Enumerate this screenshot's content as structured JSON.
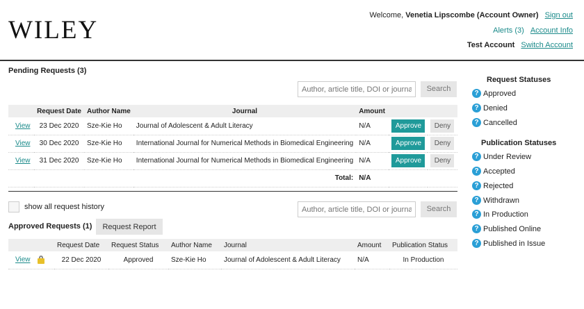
{
  "header": {
    "logo": "WILEY",
    "welcome_prefix": "Welcome, ",
    "user_name": "Venetia Lipscombe (Account Owner)",
    "sign_out": "Sign out",
    "alerts": "Alerts (3)",
    "account_info": "Account Info",
    "test_account": "Test Account",
    "switch_account": "Switch Account"
  },
  "pending": {
    "title": "Pending Requests (3)",
    "search_placeholder": "Author, article title, DOI or journal",
    "search_button": "Search",
    "columns": [
      "",
      "Request Date",
      "Author Name",
      "Journal",
      "Amount",
      "",
      ""
    ],
    "rows": [
      {
        "view": "View",
        "date": "23 Dec 2020",
        "author": "Sze-Kie Ho",
        "journal": "Journal of Adolescent & Adult Literacy",
        "amount": "N/A",
        "approve": "Approve",
        "deny": "Deny"
      },
      {
        "view": "View",
        "date": "30 Dec 2020",
        "author": "Sze-Kie Ho",
        "journal": "International Journal for Numerical Methods in Biomedical Engineering",
        "amount": "N/A",
        "approve": "Approve",
        "deny": "Deny"
      },
      {
        "view": "View",
        "date": "31 Dec 2020",
        "author": "Sze-Kie Ho",
        "journal": "International Journal for Numerical Methods in Biomedical Engineering",
        "amount": "N/A",
        "approve": "Approve",
        "deny": "Deny"
      }
    ],
    "total_label": "Total:",
    "total_value": "N/A"
  },
  "history": {
    "checkbox_label": "show all request history",
    "search_placeholder": "Author, article title, DOI or journal",
    "search_button": "Search"
  },
  "approved": {
    "title": "Approved Requests (1)",
    "report_button": "Request Report",
    "columns": [
      "",
      "Request Date",
      "Request Status",
      "Author Name",
      "Journal",
      "Amount",
      "Publication Status"
    ],
    "rows": [
      {
        "view": "View",
        "date": "22 Dec 2020",
        "status": "Approved",
        "author": "Sze-Kie Ho",
        "journal": "Journal of Adolescent & Adult Literacy",
        "amount": "N/A",
        "pub_status": "In Production"
      }
    ]
  },
  "legend": {
    "request_title": "Request Statuses",
    "request_items": [
      "Approved",
      "Denied",
      "Cancelled"
    ],
    "publication_title": "Publication Statuses",
    "publication_items": [
      "Under Review",
      "Accepted",
      "Rejected",
      "Withdrawn",
      "In Production",
      "Published Online",
      "Published in Issue"
    ],
    "icon": "help-question-icon"
  },
  "colors": {
    "accent": "#1f9a9a",
    "link": "#1a8a8a",
    "help_icon": "#2a9fd6"
  }
}
